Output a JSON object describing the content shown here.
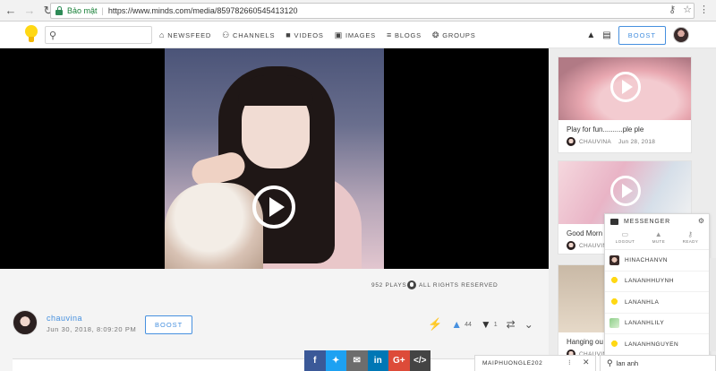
{
  "browser": {
    "secure_label": "Bảo mật",
    "url": "https://www.minds.com/media/859782660545413120"
  },
  "header": {
    "search_placeholder": "",
    "nav": [
      {
        "label": "NEWSFEED"
      },
      {
        "label": "CHANNELS"
      },
      {
        "label": "VIDEOS"
      },
      {
        "label": "IMAGES"
      },
      {
        "label": "BLOGS"
      },
      {
        "label": "GROUPS"
      }
    ],
    "boost_label": "BOOST"
  },
  "media": {
    "plays": "952 PLAYS",
    "rights": "ALL RIGHTS RESERVED"
  },
  "owner": {
    "name": "chauvina",
    "date": "Jun 30, 2018, 8:09:20 PM",
    "boost_label": "BOOST",
    "thumbs_up_count": "44",
    "thumbs_down_count": "1"
  },
  "sidebar": {
    "cards": [
      {
        "title": "Play for fun..........ple ple",
        "author": "CHAUVINA",
        "date": "Jun 28, 2018"
      },
      {
        "title": "Good Morn",
        "author": "CHAUVINA",
        "date": ""
      },
      {
        "title": "Hanging ou",
        "author": "CHAUVINA",
        "date": ""
      }
    ]
  },
  "messenger": {
    "title": "MESSENGER",
    "tools": [
      {
        "label": "LOGOUT"
      },
      {
        "label": "MUTE"
      },
      {
        "label": "READY"
      }
    ],
    "contacts": [
      {
        "name": "HINACHANVN"
      },
      {
        "name": "LANANHHUYNH"
      },
      {
        "name": "LANANHLA"
      },
      {
        "name": "LANANHLILY"
      },
      {
        "name": "LANANHNGUYEN"
      }
    ]
  },
  "share": {
    "facebook": "f",
    "email": "✉",
    "linkedin": "in",
    "googleplus": "G+",
    "embed": "</>"
  },
  "chatbar": {
    "name": "MAIPHUONGLE202",
    "more": "⁝",
    "close": "✕"
  },
  "contact_search": {
    "value": "lan anh"
  },
  "colors": {
    "accent": "#4690df",
    "secure_green": "#188038",
    "facebook": "#3b5998",
    "twitter": "#1da1f2",
    "linkedin": "#0077b5",
    "googleplus": "#dd4b39"
  }
}
